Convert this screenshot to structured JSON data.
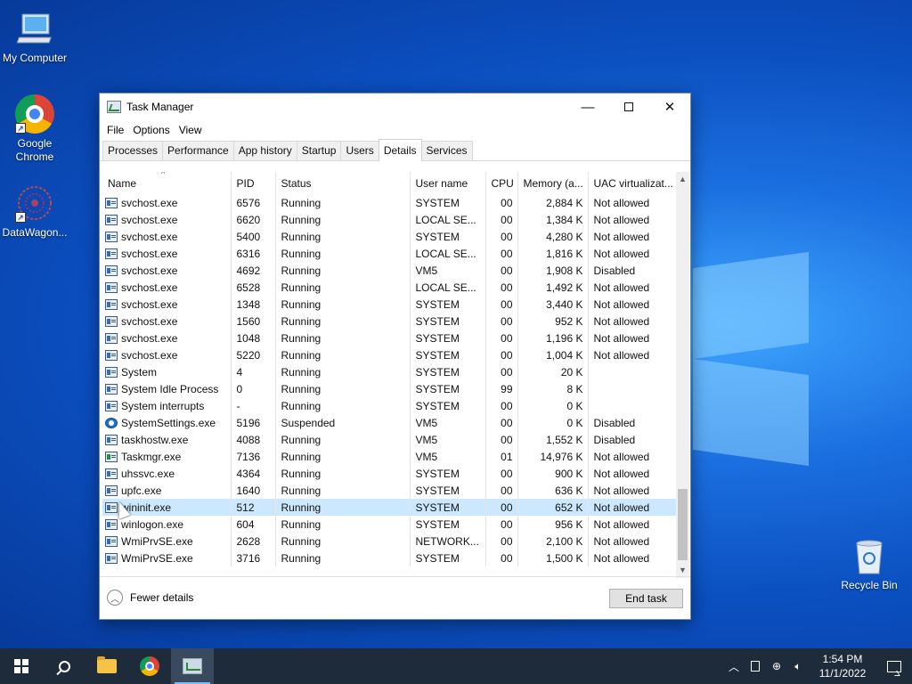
{
  "desktop": {
    "icons": [
      {
        "label": "My Computer",
        "icon": "computer-icon"
      },
      {
        "label": "Google Chrome",
        "icon": "chrome-icon"
      },
      {
        "label": "DataWagon...",
        "icon": "datawagon-icon"
      },
      {
        "label": "Recycle Bin",
        "icon": "recycle-bin-icon"
      }
    ]
  },
  "window": {
    "title": "Task Manager",
    "menu": [
      "File",
      "Options",
      "View"
    ],
    "tabs": [
      "Processes",
      "Performance",
      "App history",
      "Startup",
      "Users",
      "Details",
      "Services"
    ],
    "active_tab": "Details",
    "columns": [
      "Name",
      "PID",
      "Status",
      "User name",
      "CPU",
      "Memory (a...",
      "UAC virtualizat..."
    ],
    "rows": [
      {
        "name": "svchost.exe",
        "pid": "6576",
        "status": "Running",
        "user": "SYSTEM",
        "cpu": "00",
        "mem": "2,884 K",
        "uac": "Not allowed",
        "icon": "generic"
      },
      {
        "name": "svchost.exe",
        "pid": "6620",
        "status": "Running",
        "user": "LOCAL SE...",
        "cpu": "00",
        "mem": "1,384 K",
        "uac": "Not allowed",
        "icon": "generic"
      },
      {
        "name": "svchost.exe",
        "pid": "5400",
        "status": "Running",
        "user": "SYSTEM",
        "cpu": "00",
        "mem": "4,280 K",
        "uac": "Not allowed",
        "icon": "generic"
      },
      {
        "name": "svchost.exe",
        "pid": "6316",
        "status": "Running",
        "user": "LOCAL SE...",
        "cpu": "00",
        "mem": "1,816 K",
        "uac": "Not allowed",
        "icon": "generic"
      },
      {
        "name": "svchost.exe",
        "pid": "4692",
        "status": "Running",
        "user": "VM5",
        "cpu": "00",
        "mem": "1,908 K",
        "uac": "Disabled",
        "icon": "generic"
      },
      {
        "name": "svchost.exe",
        "pid": "6528",
        "status": "Running",
        "user": "LOCAL SE...",
        "cpu": "00",
        "mem": "1,492 K",
        "uac": "Not allowed",
        "icon": "generic"
      },
      {
        "name": "svchost.exe",
        "pid": "1348",
        "status": "Running",
        "user": "SYSTEM",
        "cpu": "00",
        "mem": "3,440 K",
        "uac": "Not allowed",
        "icon": "generic"
      },
      {
        "name": "svchost.exe",
        "pid": "1560",
        "status": "Running",
        "user": "SYSTEM",
        "cpu": "00",
        "mem": "952 K",
        "uac": "Not allowed",
        "icon": "generic"
      },
      {
        "name": "svchost.exe",
        "pid": "1048",
        "status": "Running",
        "user": "SYSTEM",
        "cpu": "00",
        "mem": "1,196 K",
        "uac": "Not allowed",
        "icon": "generic"
      },
      {
        "name": "svchost.exe",
        "pid": "5220",
        "status": "Running",
        "user": "SYSTEM",
        "cpu": "00",
        "mem": "1,004 K",
        "uac": "Not allowed",
        "icon": "generic"
      },
      {
        "name": "System",
        "pid": "4",
        "status": "Running",
        "user": "SYSTEM",
        "cpu": "00",
        "mem": "20 K",
        "uac": "",
        "icon": "generic"
      },
      {
        "name": "System Idle Process",
        "pid": "0",
        "status": "Running",
        "user": "SYSTEM",
        "cpu": "99",
        "mem": "8 K",
        "uac": "",
        "icon": "generic"
      },
      {
        "name": "System interrupts",
        "pid": "-",
        "status": "Running",
        "user": "SYSTEM",
        "cpu": "00",
        "mem": "0 K",
        "uac": "",
        "icon": "generic"
      },
      {
        "name": "SystemSettings.exe",
        "pid": "5196",
        "status": "Suspended",
        "user": "VM5",
        "cpu": "00",
        "mem": "0 K",
        "uac": "Disabled",
        "icon": "gear"
      },
      {
        "name": "taskhostw.exe",
        "pid": "4088",
        "status": "Running",
        "user": "VM5",
        "cpu": "00",
        "mem": "1,552 K",
        "uac": "Disabled",
        "icon": "generic"
      },
      {
        "name": "Taskmgr.exe",
        "pid": "7136",
        "status": "Running",
        "user": "VM5",
        "cpu": "01",
        "mem": "14,976 K",
        "uac": "Not allowed",
        "icon": "taskmgr"
      },
      {
        "name": "uhssvc.exe",
        "pid": "4364",
        "status": "Running",
        "user": "SYSTEM",
        "cpu": "00",
        "mem": "900 K",
        "uac": "Not allowed",
        "icon": "generic"
      },
      {
        "name": "upfc.exe",
        "pid": "1640",
        "status": "Running",
        "user": "SYSTEM",
        "cpu": "00",
        "mem": "636 K",
        "uac": "Not allowed",
        "icon": "generic"
      },
      {
        "name": "wininit.exe",
        "pid": "512",
        "status": "Running",
        "user": "SYSTEM",
        "cpu": "00",
        "mem": "652 K",
        "uac": "Not allowed",
        "icon": "generic",
        "selected": true
      },
      {
        "name": "winlogon.exe",
        "pid": "604",
        "status": "Running",
        "user": "SYSTEM",
        "cpu": "00",
        "mem": "956 K",
        "uac": "Not allowed",
        "icon": "generic"
      },
      {
        "name": "WmiPrvSE.exe",
        "pid": "2628",
        "status": "Running",
        "user": "NETWORK...",
        "cpu": "00",
        "mem": "2,100 K",
        "uac": "Not allowed",
        "icon": "generic"
      },
      {
        "name": "WmiPrvSE.exe",
        "pid": "3716",
        "status": "Running",
        "user": "SYSTEM",
        "cpu": "00",
        "mem": "1,500 K",
        "uac": "Not allowed",
        "icon": "generic"
      }
    ],
    "footer": {
      "fewer_details": "Fewer details",
      "end_task": "End task"
    }
  },
  "taskbar": {
    "clock_time": "1:54 PM",
    "clock_date": "11/1/2022"
  },
  "colors": {
    "selected_row": "#cce8ff",
    "taskbar": "#1d2b3b"
  }
}
